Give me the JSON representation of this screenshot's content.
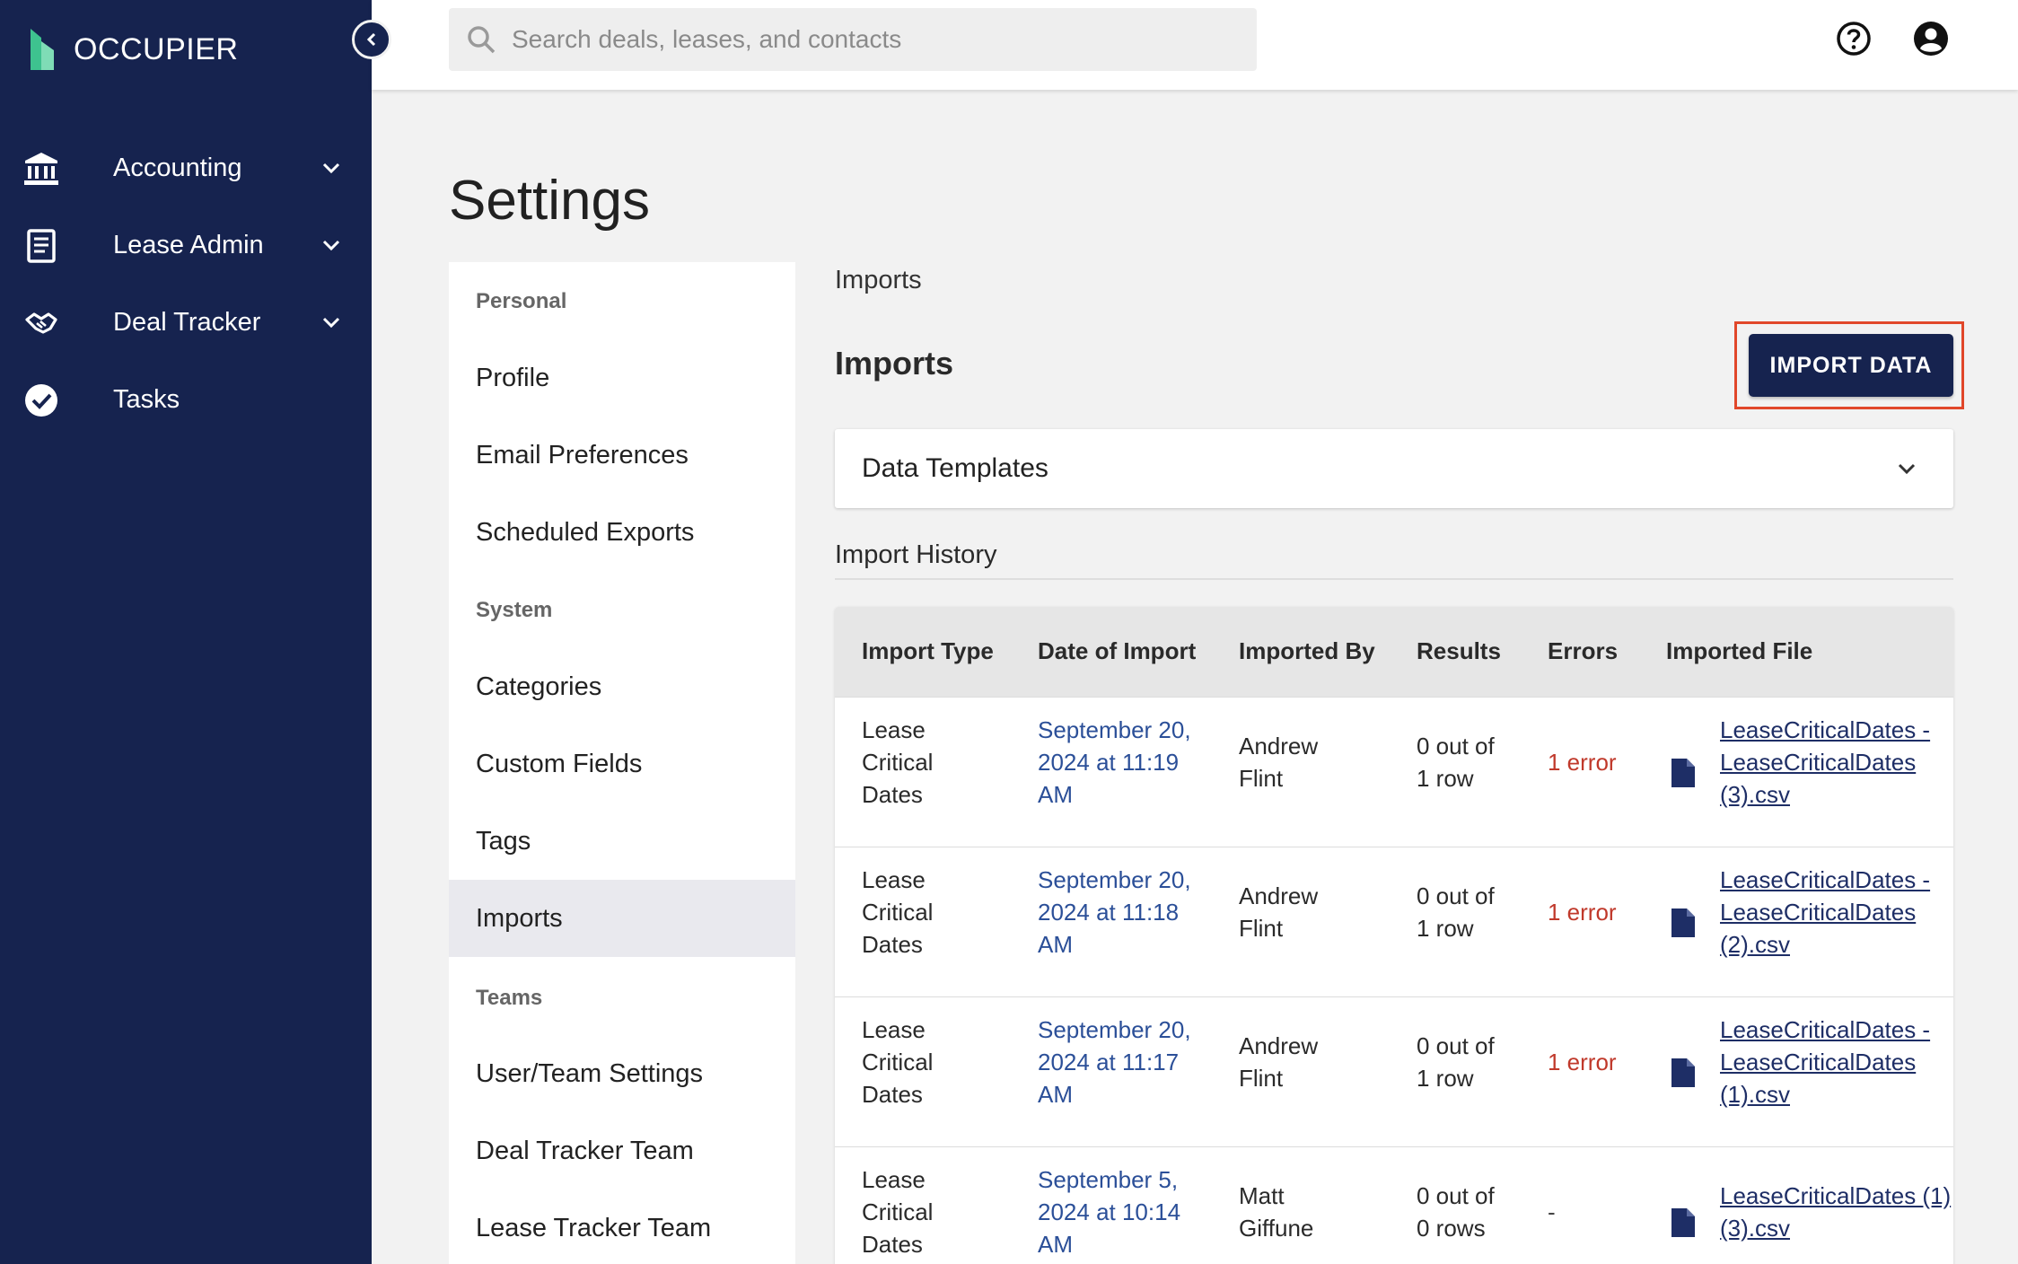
{
  "app": {
    "brand": "OCCUPIER",
    "brand_color": "#16234f",
    "accent_green": "#3ec28f"
  },
  "sidebar": {
    "items": [
      {
        "label": "Accounting",
        "icon": "bank-icon",
        "expandable": true
      },
      {
        "label": "Lease Admin",
        "icon": "document-icon",
        "expandable": true
      },
      {
        "label": "Deal Tracker",
        "icon": "handshake-icon",
        "expandable": true
      },
      {
        "label": "Tasks",
        "icon": "check-circle-icon",
        "expandable": false
      }
    ]
  },
  "topbar": {
    "search_placeholder": "Search deals, leases, and contacts"
  },
  "page": {
    "title": "Settings"
  },
  "settings_nav": {
    "sections": [
      {
        "title": "Personal",
        "items": [
          "Profile",
          "Email Preferences",
          "Scheduled Exports"
        ]
      },
      {
        "title": "System",
        "items": [
          "Categories",
          "Custom Fields",
          "Tags",
          "Imports"
        ]
      },
      {
        "title": "Teams",
        "items": [
          "User/Team Settings",
          "Deal Tracker Team",
          "Lease Tracker Team"
        ]
      }
    ],
    "active": "Imports"
  },
  "main": {
    "breadcrumb": "Imports",
    "heading": "Imports",
    "import_button": "IMPORT DATA",
    "accordion_label": "Data Templates",
    "history_label": "Import History",
    "table": {
      "columns": [
        "Import Type",
        "Date of Import",
        "Imported By",
        "Results",
        "Errors",
        "Imported File"
      ],
      "rows": [
        {
          "type": [
            "Lease",
            "Critical",
            "Dates"
          ],
          "date": [
            "September 20,",
            "2024 at 11:19",
            "AM"
          ],
          "by": [
            "Andrew",
            "Flint"
          ],
          "results": [
            "0 out of",
            "1 row"
          ],
          "errors": "1 error",
          "file": [
            "LeaseCriticalDates -",
            "LeaseCriticalDates",
            "(3).csv"
          ]
        },
        {
          "type": [
            "Lease",
            "Critical",
            "Dates"
          ],
          "date": [
            "September 20,",
            "2024 at 11:18",
            "AM"
          ],
          "by": [
            "Andrew",
            "Flint"
          ],
          "results": [
            "0 out of",
            "1 row"
          ],
          "errors": "1 error",
          "file": [
            "LeaseCriticalDates -",
            "LeaseCriticalDates",
            "(2).csv"
          ]
        },
        {
          "type": [
            "Lease",
            "Critical",
            "Dates"
          ],
          "date": [
            "September 20,",
            "2024 at 11:17",
            "AM"
          ],
          "by": [
            "Andrew",
            "Flint"
          ],
          "results": [
            "0 out of",
            "1 row"
          ],
          "errors": "1 error",
          "file": [
            "LeaseCriticalDates -",
            "LeaseCriticalDates",
            "(1).csv"
          ]
        },
        {
          "type": [
            "Lease",
            "Critical",
            "Dates"
          ],
          "date": [
            "September 5,",
            "2024 at 10:14",
            "AM"
          ],
          "by": [
            "Matt",
            "Giffune"
          ],
          "results": [
            "0 out of",
            "0 rows"
          ],
          "errors": "-",
          "file": [
            "LeaseCriticalDates (1)",
            "(3).csv"
          ]
        }
      ]
    }
  }
}
